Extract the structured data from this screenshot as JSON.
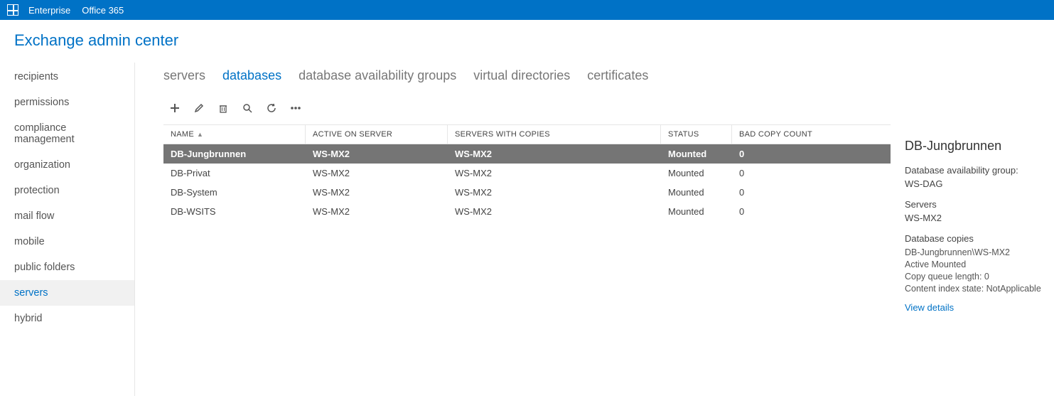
{
  "topbar": {
    "enterprise_label": "Enterprise",
    "office365_label": "Office 365"
  },
  "app_title": "Exchange admin center",
  "sidebar": {
    "items": [
      {
        "label": "recipients"
      },
      {
        "label": "permissions"
      },
      {
        "label": "compliance management"
      },
      {
        "label": "organization"
      },
      {
        "label": "protection"
      },
      {
        "label": "mail flow"
      },
      {
        "label": "mobile"
      },
      {
        "label": "public folders"
      },
      {
        "label": "servers"
      },
      {
        "label": "hybrid"
      }
    ],
    "active_index": 8
  },
  "tabs": {
    "items": [
      {
        "label": "servers"
      },
      {
        "label": "databases"
      },
      {
        "label": "database availability groups"
      },
      {
        "label": "virtual directories"
      },
      {
        "label": "certificates"
      }
    ],
    "active_index": 1
  },
  "grid": {
    "columns": {
      "name": "NAME",
      "active": "ACTIVE ON SERVER",
      "copies": "SERVERS WITH COPIES",
      "status": "STATUS",
      "bad": "BAD COPY COUNT"
    },
    "rows": [
      {
        "name": "DB-Jungbrunnen",
        "active": "WS-MX2",
        "copies": "WS-MX2",
        "status": "Mounted",
        "bad": "0"
      },
      {
        "name": "DB-Privat",
        "active": "WS-MX2",
        "copies": "WS-MX2",
        "status": "Mounted",
        "bad": "0"
      },
      {
        "name": "DB-System",
        "active": "WS-MX2",
        "copies": "WS-MX2",
        "status": "Mounted",
        "bad": "0"
      },
      {
        "name": "DB-WSITS",
        "active": "WS-MX2",
        "copies": "WS-MX2",
        "status": "Mounted",
        "bad": "0"
      }
    ],
    "selected_index": 0
  },
  "details": {
    "title": "DB-Jungbrunnen",
    "dag_label": "Database availability group:",
    "dag_value": "WS-DAG",
    "servers_label": "Servers",
    "servers_value": "WS-MX2",
    "copies_label": "Database copies",
    "copy_line1": "DB-Jungbrunnen\\WS-MX2",
    "copy_line2": "Active Mounted",
    "copy_line3": "Copy queue length:  0",
    "copy_line4": "Content index state:  NotApplicable",
    "view_details": "View details"
  }
}
